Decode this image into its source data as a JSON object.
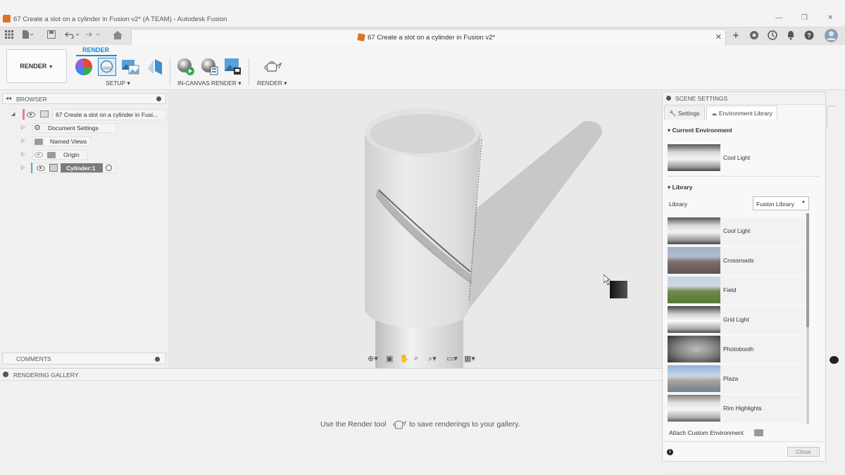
{
  "window": {
    "title": "67 Create a slot on a cylinder in Fusion v2* (A TEAM) - Autodesk Fusion",
    "minimize": "—",
    "restore": "❐",
    "close": "✕"
  },
  "tabbar": {
    "doc_title": "67 Create a slot on a cylinder in Fusion v2*",
    "close": "✕",
    "new_tab": "+"
  },
  "toolbar": {
    "workspace_label": "RENDER",
    "active_tab": "RENDER",
    "groups": {
      "setup": "SETUP",
      "in_canvas": "IN-CANVAS RENDER",
      "render": "RENDER"
    }
  },
  "browser": {
    "title": "BROWSER",
    "root_label": "67 Create a slot on a cylinder in Fusi...",
    "items": [
      {
        "label": "Document Settings"
      },
      {
        "label": "Named Views"
      },
      {
        "label": "Origin"
      },
      {
        "label": "Cylinder:1"
      }
    ]
  },
  "comments": {
    "title": "COMMENTS"
  },
  "gallery": {
    "title": "RENDERING GALLERY",
    "msg_before": "Use the Render tool",
    "msg_after": "to save renderings to your gallery."
  },
  "scene": {
    "title": "SCENE SETTINGS",
    "tabs": [
      {
        "label": "Settings"
      },
      {
        "label": "Environment Library"
      }
    ],
    "current_env_title": "Current Environment",
    "current_env": "Cool Light",
    "library_title": "Library",
    "library_label": "Library",
    "library_select": "Fusion Library",
    "environments": [
      {
        "name": "Cool Light",
        "thumb": "cool"
      },
      {
        "name": "Crossroads",
        "thumb": "cross"
      },
      {
        "name": "Field",
        "thumb": "field"
      },
      {
        "name": "Grid Light",
        "thumb": "grid"
      },
      {
        "name": "Photobooth",
        "thumb": "photo"
      },
      {
        "name": "Plaza",
        "thumb": "plaza"
      },
      {
        "name": "Rim Highlights",
        "thumb": "rim"
      }
    ],
    "attach_label": "Attach Custom Environment",
    "close_label": "Close"
  },
  "colors": {
    "accent": "#1a8ad4",
    "brand": "#e0731f"
  }
}
